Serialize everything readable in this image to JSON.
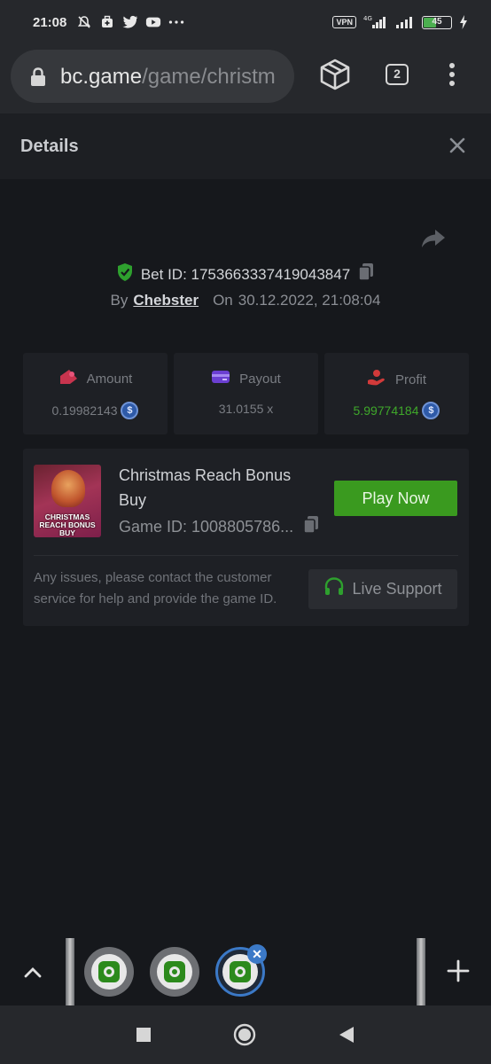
{
  "status_bar": {
    "time": "21:08",
    "vpn": "VPN",
    "network": "4G",
    "battery": "45"
  },
  "browser": {
    "url_domain": "bc.game",
    "url_path": "/game/christm",
    "tab_count": "2"
  },
  "details": {
    "title": "Details"
  },
  "bet": {
    "bet_id_text": "Bet ID: 1753663337419043847",
    "by_label": "By",
    "username": "Chebster",
    "on_label": "On",
    "datetime": "30.12.2022, 21:08:04"
  },
  "stats": {
    "amount_label": "Amount",
    "amount_value": "0.19982143",
    "payout_label": "Payout",
    "payout_value": "31.0155 x",
    "profit_label": "Profit",
    "profit_value": "5.99774184",
    "coin_symbol": "$"
  },
  "game": {
    "thumb_text": "CHRISTMAS REACH BONUS BUY",
    "name": "Christmas Reach Bonus Buy",
    "game_id_text": "Game ID: 1008805786...",
    "play_label": "Play Now",
    "issue_text": "Any issues, please contact the customer service for help and provide the game ID.",
    "support_label": "Live Support"
  },
  "colors": {
    "accent_green": "#3a9a1f",
    "profit_green": "#3fa82a",
    "tab_active": "#3b79c7"
  }
}
